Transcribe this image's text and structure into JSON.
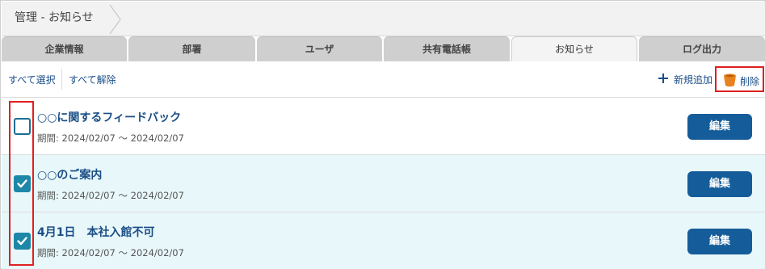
{
  "breadcrumb": {
    "label": "管理 - お知らせ"
  },
  "tabs": [
    {
      "label": "企業情報",
      "active": false
    },
    {
      "label": "部署",
      "active": false
    },
    {
      "label": "ユーザ",
      "active": false
    },
    {
      "label": "共有電話帳",
      "active": false
    },
    {
      "label": "お知らせ",
      "active": true
    },
    {
      "label": "ログ出力",
      "active": false
    }
  ],
  "toolbar": {
    "select_all": "すべて選択",
    "deselect_all": "すべて解除",
    "add_label": "新規追加",
    "delete_label": "削除"
  },
  "notices": [
    {
      "title": "○○に関するフィードバック",
      "period": "期間: 2024/02/07 〜 2024/02/07",
      "checked": false,
      "edit_label": "編集"
    },
    {
      "title": "○○のご案内",
      "period": "期間: 2024/02/07 〜 2024/02/07",
      "checked": true,
      "edit_label": "編集"
    },
    {
      "title": "4月1日　本社入館不可",
      "period": "期間: 2024/02/07 〜 2024/02/07",
      "checked": true,
      "edit_label": "編集"
    }
  ],
  "colors": {
    "link": "#1b4e86",
    "edit_button": "#155c9a",
    "checkbox_checked": "#1d87a8",
    "checked_row_bg": "#e8f7fa",
    "delete_icon": "#e8821e",
    "highlight": "#e02020"
  },
  "icons": {
    "add": "plus-icon",
    "delete": "bucket-icon",
    "check": "checkmark-icon",
    "breadcrumb_separator": "chevron-right-icon"
  }
}
